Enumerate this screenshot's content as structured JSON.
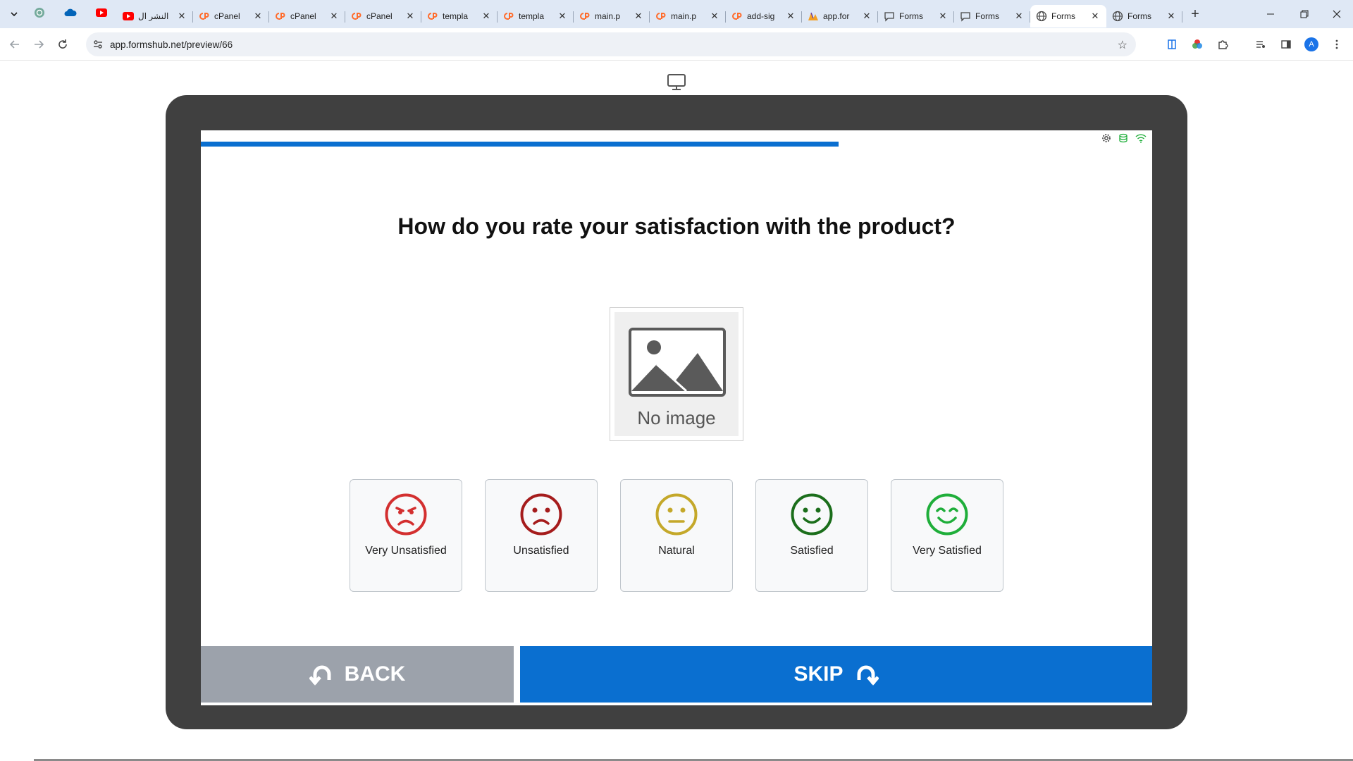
{
  "browser": {
    "tabs": [
      {
        "title": "",
        "icon": "chatgpt-icon",
        "pinned": true
      },
      {
        "title": "",
        "icon": "onedrive-cloud-icon",
        "pinned": true
      },
      {
        "title": "",
        "icon": "youtube-icon",
        "pinned": true
      },
      {
        "title": "النشر ال",
        "icon": "youtube-icon"
      },
      {
        "title": "cPanel",
        "icon": "cpanel-icon"
      },
      {
        "title": "cPanel",
        "icon": "cpanel-icon"
      },
      {
        "title": "cPanel",
        "icon": "cpanel-icon"
      },
      {
        "title": "templa",
        "icon": "cpanel-icon"
      },
      {
        "title": "templa",
        "icon": "cpanel-icon"
      },
      {
        "title": "main.p",
        "icon": "cpanel-icon"
      },
      {
        "title": "main.p",
        "icon": "cpanel-icon"
      },
      {
        "title": "add-sig",
        "icon": "cpanel-icon"
      },
      {
        "title": "app.for",
        "icon": "formshub-icon"
      },
      {
        "title": "Forms",
        "icon": "chat-bubble-icon"
      },
      {
        "title": "Forms",
        "icon": "chat-bubble-icon"
      },
      {
        "title": "Forms",
        "icon": "globe-icon",
        "active": true
      },
      {
        "title": "Forms",
        "icon": "globe-icon"
      }
    ],
    "url": "app.formshub.net/preview/66",
    "profile_initial": "A"
  },
  "survey": {
    "progress_percent": 67,
    "question": "How do you rate your satisfaction with the product?",
    "image_caption": "No image",
    "options": [
      {
        "label": "Very Unsatisfied",
        "color": "#d32f2f",
        "face": "angry"
      },
      {
        "label": "Unsatisfied",
        "color": "#a51c1c",
        "face": "sad"
      },
      {
        "label": "Natural",
        "color": "#c4a82a",
        "face": "neutral"
      },
      {
        "label": "Satisfied",
        "color": "#1b6e1b",
        "face": "smile"
      },
      {
        "label": "Very Satisfied",
        "color": "#1fae3a",
        "face": "happy"
      }
    ],
    "back_label": "BACK",
    "skip_label": "SKIP"
  },
  "colors": {
    "primary": "#0a6fd0",
    "back_button": "#9ca2ab",
    "device_frame": "#404040"
  }
}
